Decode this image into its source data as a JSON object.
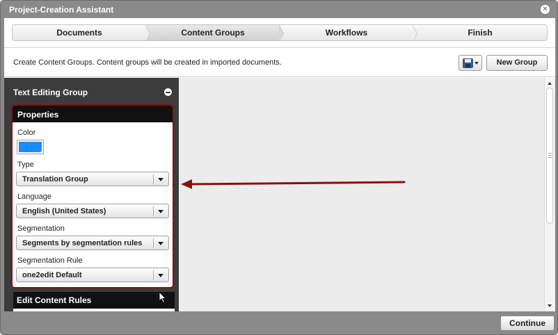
{
  "window": {
    "title": "Project-Creation Assistant",
    "close_icon": "close-icon"
  },
  "wizard": {
    "steps": [
      {
        "label": "Documents",
        "active": false
      },
      {
        "label": "Content Groups",
        "active": true
      },
      {
        "label": "Workflows",
        "active": false
      },
      {
        "label": "Finish",
        "active": false
      }
    ]
  },
  "infobar": {
    "text": "Create Content Groups. Content groups will be created in imported documents.",
    "save_icon": "save-icon",
    "new_group_label": "New Group"
  },
  "sidebar": {
    "group_title": "Text Editing Group",
    "properties": {
      "header": "Properties",
      "color_label": "Color",
      "color_value": "#1a8cff",
      "type_label": "Type",
      "type_value": "Translation Group",
      "language_label": "Language",
      "language_value": "English (United States)",
      "segmentation_label": "Segmentation",
      "segmentation_value": "Segments by segmentation rules",
      "rule_label": "Segmentation Rule",
      "rule_value": "one2edit Default"
    },
    "edit_rules_header": "Edit Content Rules"
  },
  "footer": {
    "continue_label": "Continue"
  },
  "colors": {
    "annotation_arrow": "#8b0f0f",
    "highlight_border": "#8b0f0f"
  }
}
